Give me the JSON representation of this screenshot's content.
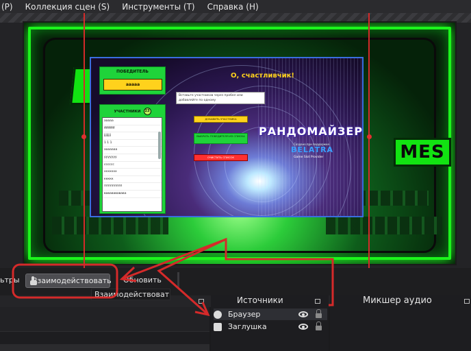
{
  "menu": {
    "items": [
      {
        "label": "(P)"
      },
      {
        "label": "Коллекция сцен (S)"
      },
      {
        "label": "Инструменты (T)"
      },
      {
        "label": "Справка (H)"
      }
    ]
  },
  "scene": {
    "banner_right": "MES"
  },
  "widget": {
    "winner_label": "ПОБЕДИТЕЛЬ",
    "winner_value": "aaaaa",
    "participants_label": "УЧАСТНИКИ",
    "participants_count": "23",
    "participants": [
      "aaaaa",
      "ffffffffff",
      "jjjjjjjj",
      "1 1 1",
      "ааааааа",
      "ууууууу",
      "сссссс",
      "ххххххх",
      "ккккк",
      "ппппппппп",
      "вававававава"
    ],
    "title": "О, счастливчик!",
    "input_placeholder": "Вставьте участников через пробел или добавляйте по одному",
    "add_button": "ДОБАВИТЬ УЧАСТНИКА",
    "pick_button": "ВЫБРАТЬ ПОБЕДИТЕЛЯ ИЗ СПИСКА",
    "clear_button": "ОЧИСТИТЬ СПИСОК",
    "brand": "РАНДОМАЙЗЕР",
    "brand_sub": "Создано при поддержке",
    "brand_logo": "BELATRA",
    "brand_tag": "Game Slot Provider"
  },
  "toolbar": {
    "left_fragment": "ьтры",
    "interact_label": "Взаимодействовать",
    "refresh_label": "Обновить",
    "tooltip": "Взаимодействовать"
  },
  "sources": {
    "title": "Источники",
    "items": [
      {
        "name": "Браузер",
        "icon": "globe-icon"
      },
      {
        "name": "Заглушка",
        "icon": "image-icon"
      }
    ]
  },
  "mixer": {
    "title": "Микшер аудио"
  },
  "colors": {
    "annotation": "#d52a2a",
    "accent_green": "#1fd33a",
    "accent_yellow": "#ffd21c"
  }
}
